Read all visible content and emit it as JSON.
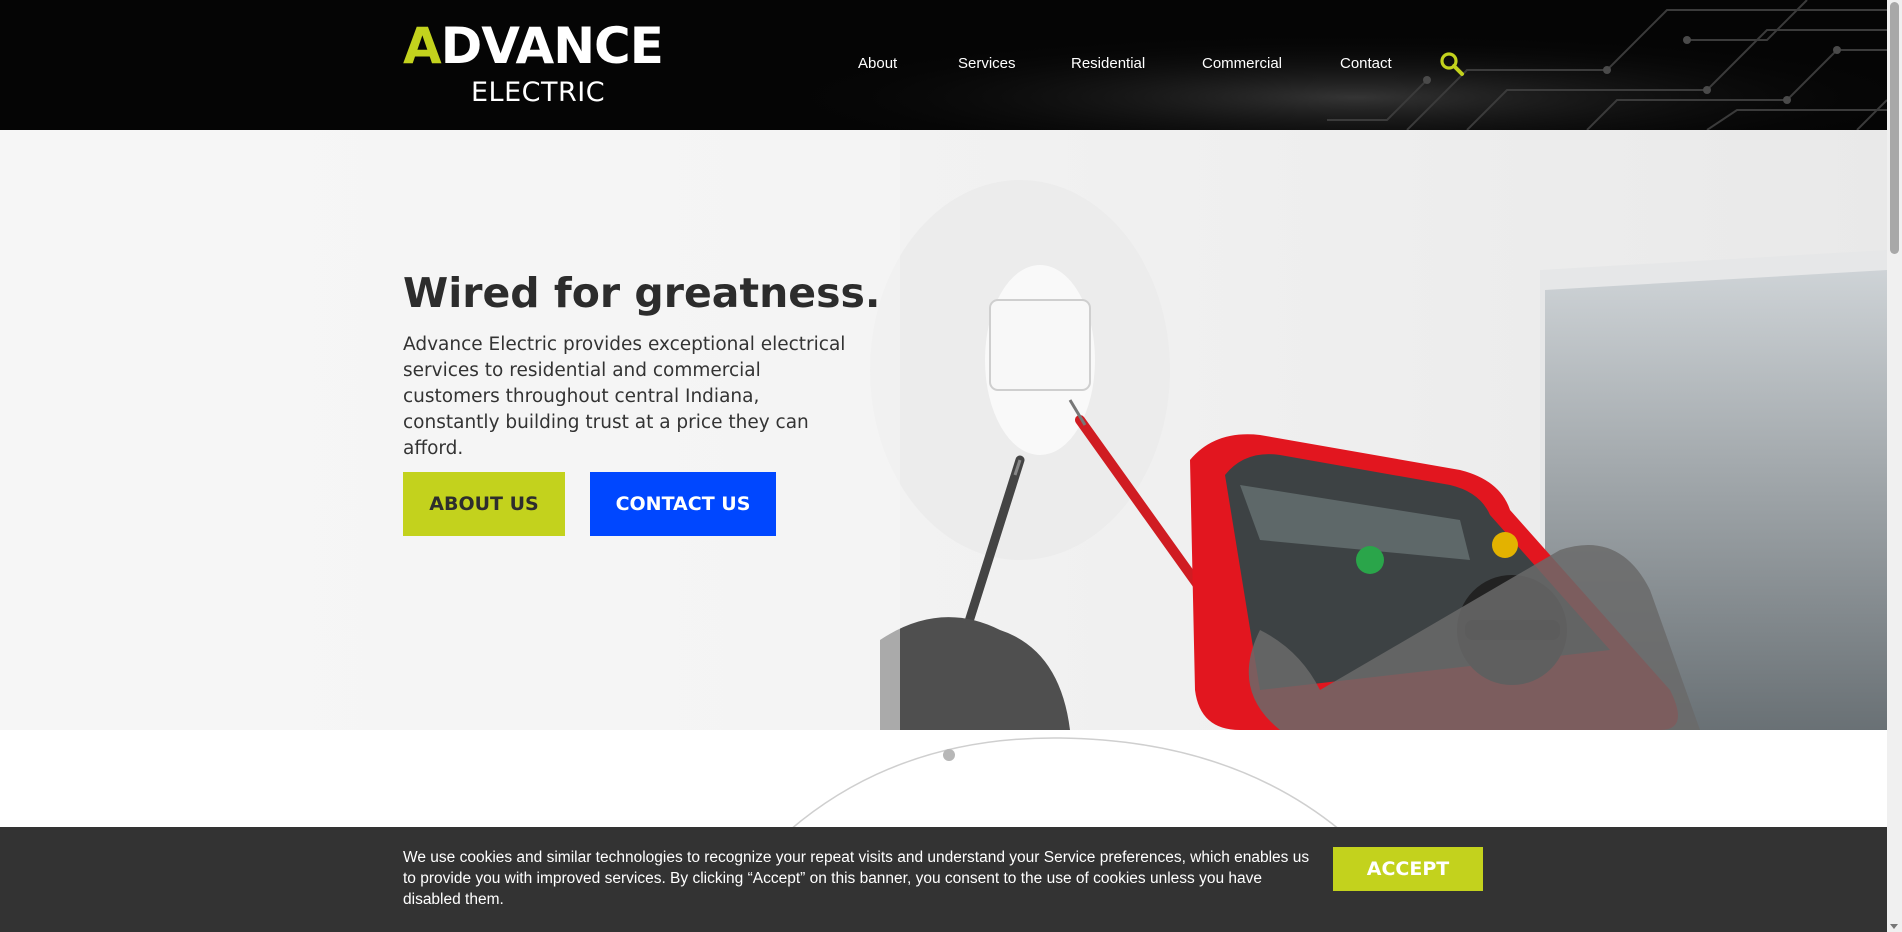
{
  "header": {
    "logo": {
      "word_first_letter": "A",
      "word_rest": "DVANCE",
      "subtitle": "ELECTRIC"
    },
    "nav": [
      {
        "label": "About"
      },
      {
        "label": "Services"
      },
      {
        "label": "Residential"
      },
      {
        "label": "Commercial"
      },
      {
        "label": "Contact"
      }
    ],
    "search_icon": "search-icon"
  },
  "hero": {
    "title": "Wired for greatness.",
    "text": "Advance Electric provides exceptional electrical services to residential and commercial customers throughout central Indiana, constantly building trust at a price they can afford.",
    "about_button": "ABOUT US",
    "contact_button": "CONTACT US",
    "image": "multimeter-photo"
  },
  "cookie_banner": {
    "text": "We use cookies and similar technologies to recognize your repeat visits and understand your Service preferences, which enables us to provide you with improved services. By clicking “Accept” on this banner, you consent to the use of cookies unless you have disabled them.",
    "accept_label": "ACCEPT"
  },
  "colors": {
    "brand_lime": "#c3d21d",
    "brand_blue": "#0047ff",
    "header_bg": "#050505",
    "banner_bg": "#333333",
    "text_dark": "#2c2c2c"
  }
}
